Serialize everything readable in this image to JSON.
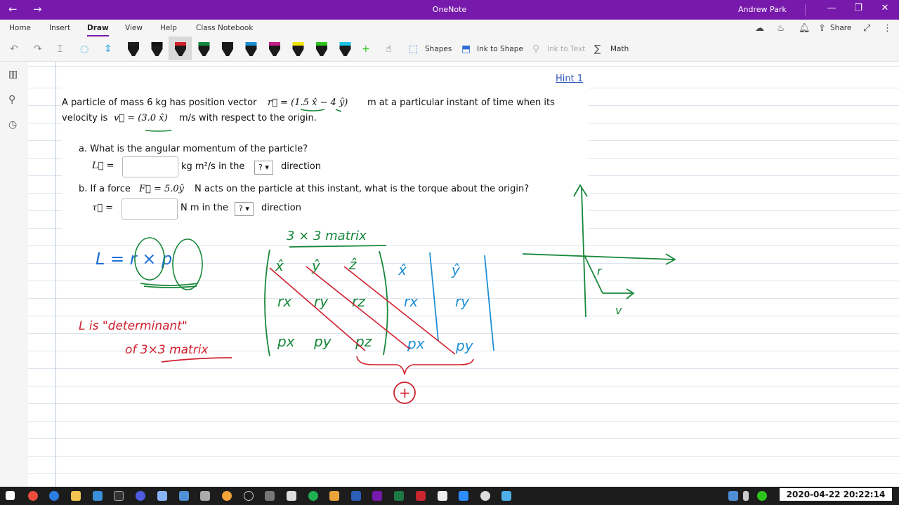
{
  "window": {
    "title": "OneNote",
    "user": "Andrew Park",
    "nav_back": "←",
    "nav_forward": "→",
    "minimize": "—",
    "restore": "❐",
    "close": "✕"
  },
  "ribbon": {
    "tabs": [
      "Home",
      "Insert",
      "Draw",
      "View",
      "Help",
      "Class Notebook"
    ],
    "active_tab": "Draw",
    "share_label": "Share",
    "tools": {
      "shapes": "Shapes",
      "ink_to_shape": "Ink to Shape",
      "ink_to_text": "Ink to Text",
      "math": "Math"
    },
    "pen_colors": [
      "#1f1f1f",
      "#111111",
      "#d6202d",
      "#0f8a3c",
      "#1a1a1a",
      "#1a8fd1",
      "#c41e8b",
      "#f2e600",
      "#2ec41e",
      "#19c6e6"
    ]
  },
  "page": {
    "hint_link": "Hint 1",
    "problem": {
      "line1_a": "A particle of mass 6 kg has position vector",
      "line1_r": "r⃗ = (1.5 x̂ − 4 ŷ)",
      "line1_b": "m at a particular instant of time when its",
      "line2_a": "velocity is",
      "line2_v": "v⃗ = (3.0 x̂)",
      "line2_b": "m/s with respect to the origin.",
      "qa_label": "a. What is the angular momentum of the particle?",
      "qa_var": "L⃗ =",
      "qa_units": "kg m²/s in the",
      "qa_select": "? ▾",
      "qa_direction": "direction",
      "qb_label_a": "b. If a force",
      "qb_force": "F⃗ = 5.0ŷ",
      "qb_label_b": "N acts on the particle at this instant, what is the torque about the origin?",
      "qb_var": "τ⃗ =",
      "qb_units": "N m in the",
      "qb_select": "? ▾",
      "qb_direction": "direction"
    },
    "ink": {
      "matrix_title": "3 × 3 matrix",
      "L_is": "L is \"determinant\"",
      "of_matrix": "of 3×3 matrix",
      "cross_eq": "L = r × p",
      "row1": [
        "x̂",
        "ŷ",
        "ẑ",
        "x̂",
        "ŷ"
      ],
      "row2": [
        "rx",
        "ry",
        "rz",
        "rx",
        "ry"
      ],
      "row3": [
        "px",
        "py",
        "pz",
        "px",
        "py"
      ],
      "plus": "+",
      "r_label": "r",
      "v_label": "v",
      "colors": {
        "green": "#18873a",
        "red": "#d11f2d",
        "blue": "#1f8fd6"
      }
    }
  },
  "taskbar": {
    "clock": "2020-04-22 20:22:14"
  }
}
